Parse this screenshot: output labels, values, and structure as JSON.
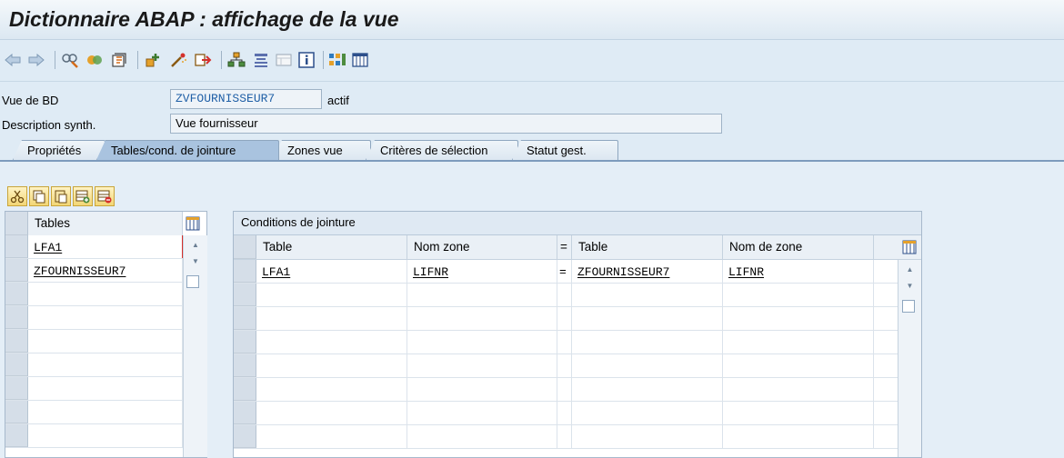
{
  "window": {
    "title": "Dictionnaire ABAP : affichage de la vue"
  },
  "toolbar": {
    "buttons": [
      {
        "icon": "back-arrow-icon"
      },
      {
        "icon": "forward-arrow-icon"
      },
      {
        "icon": "display-change-icon"
      },
      {
        "icon": "other-object-icon"
      },
      {
        "icon": "check-icon"
      },
      {
        "icon": "activate-icon"
      },
      {
        "icon": "test-icon"
      },
      {
        "icon": "where-used-icon"
      },
      {
        "icon": "hierarchy-icon"
      },
      {
        "icon": "tree-icon"
      },
      {
        "icon": "layout-icon"
      },
      {
        "icon": "info-icon"
      },
      {
        "icon": "grid-view-icon"
      },
      {
        "icon": "table-icon"
      }
    ]
  },
  "header": {
    "view_label": "Vue de BD",
    "view_name": "ZVFOURNISSEUR7",
    "view_status": "actif",
    "desc_label": "Description synth.",
    "desc_value": "Vue fournisseur"
  },
  "tabs": [
    {
      "label": "Propriétés",
      "active": false
    },
    {
      "label": "Tables/cond. de jointure",
      "active": true
    },
    {
      "label": "Zones vue",
      "active": false
    },
    {
      "label": "Critères de sélection",
      "active": false
    },
    {
      "label": "Statut gest.",
      "active": false
    }
  ],
  "edit_buttons": [
    {
      "icon": "cut-icon"
    },
    {
      "icon": "copy-icon"
    },
    {
      "icon": "paste-icon"
    },
    {
      "icon": "insert-row-icon"
    },
    {
      "icon": "delete-row-icon"
    }
  ],
  "tables_grid": {
    "header": "Tables",
    "rows": [
      "LFA1",
      "ZFOURNISSEUR7",
      "",
      "",
      "",
      "",
      "",
      "",
      ""
    ]
  },
  "join_grid": {
    "title": "Conditions de jointure",
    "columns": [
      "Table",
      "Nom zone",
      "=",
      "Table",
      "Nom de zone"
    ],
    "rows": [
      {
        "table": "LFA1",
        "field": "LIFNR",
        "eq": "=",
        "table2": "ZFOURNISSEUR7",
        "field2": "LIFNR"
      },
      {
        "table": "",
        "field": "",
        "eq": "",
        "table2": "",
        "field2": ""
      },
      {
        "table": "",
        "field": "",
        "eq": "",
        "table2": "",
        "field2": ""
      },
      {
        "table": "",
        "field": "",
        "eq": "",
        "table2": "",
        "field2": ""
      },
      {
        "table": "",
        "field": "",
        "eq": "",
        "table2": "",
        "field2": ""
      },
      {
        "table": "",
        "field": "",
        "eq": "",
        "table2": "",
        "field2": ""
      },
      {
        "table": "",
        "field": "",
        "eq": "",
        "table2": "",
        "field2": ""
      },
      {
        "table": "",
        "field": "",
        "eq": "",
        "table2": "",
        "field2": ""
      }
    ]
  },
  "colors": {
    "background": "#dfebf5",
    "active_tab": "#a9c3df",
    "link_blue": "#1f5fa6"
  }
}
